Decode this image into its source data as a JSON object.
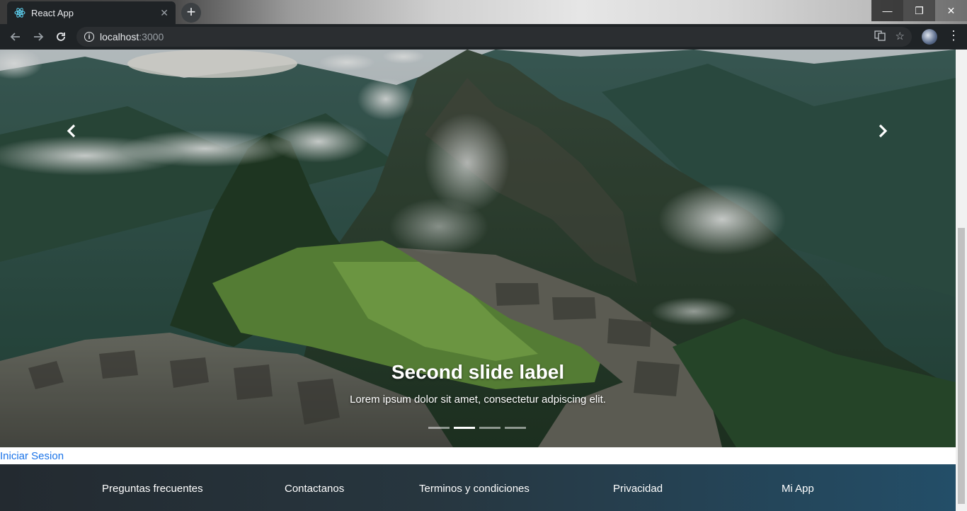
{
  "browser": {
    "tab_title": "React App",
    "tab_close": "✕",
    "new_tab": "+",
    "url_host": "localhost",
    "url_port": ":3000",
    "window_controls": {
      "minimize": "—",
      "maximize": "❐",
      "close": "✕"
    }
  },
  "carousel": {
    "slide_label": "Second slide label",
    "slide_text": "Lorem ipsum dolor sit amet, consectetur adpiscing elit.",
    "indicator_count": 4,
    "active_indicator": 2
  },
  "login_link": "Iniciar Sesion",
  "footer": {
    "links": [
      "Preguntas frecuentes",
      "Contactanos",
      "Terminos y condiciones",
      "Privacidad",
      "Mi App"
    ]
  }
}
